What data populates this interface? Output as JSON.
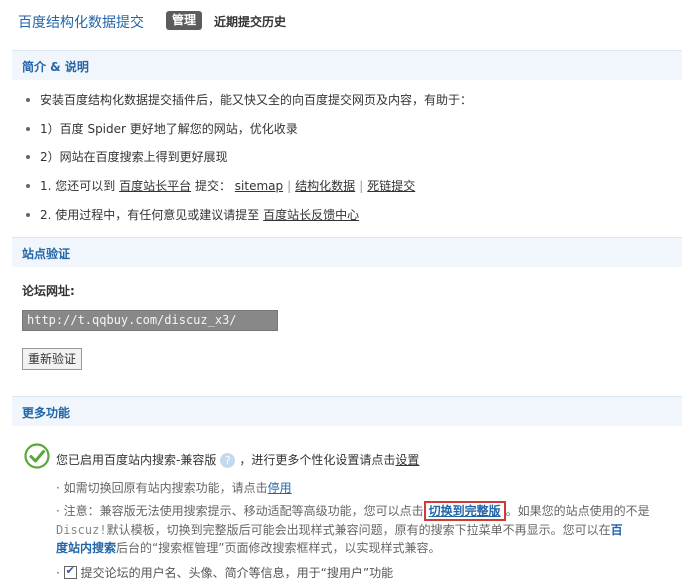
{
  "header": {
    "app_title": "百度结构化数据提交",
    "tab_manage": "管理",
    "tab_history": "近期提交历史"
  },
  "intro_section": {
    "title": "简介 & 说明",
    "lines": [
      "安装百度结构化数据提交插件后，能又快又全的向百度提交网页及内容，有助于：",
      "1）百度 Spider 更好地了解您的网站，优化收录",
      "2）网站在百度搜索上得到更好展现"
    ],
    "line4_prefix": "1. 您还可以到",
    "line4_link_platform": "百度站长平台",
    "line4_submit": "提交：",
    "line4_link_sitemap": "sitemap",
    "line4_link_structured": "结构化数据",
    "line4_link_deadlink": "死链提交",
    "line5_prefix": "2. 使用过程中，有任何意见或建议请提至",
    "line5_link_feedback": "百度站长反馈中心"
  },
  "verify_section": {
    "title": "站点验证",
    "forum_label": "论坛网址:",
    "forum_url": "http://t.qqbuy.com/discuz_x3/",
    "revalidate_button": "重新验证"
  },
  "more_section": {
    "title": "更多功能",
    "enabled_prefix": "您已启用百度站内搜索-兼容版",
    "help_icon_glyph": "?",
    "enabled_suffix": "，进行更多个性化设置请点击",
    "enabled_link": "设置",
    "switch_back_prefix": "· 如需切换回原有站内搜索功能，请点击",
    "switch_back_link": "停用",
    "note_prefix": "· 注意：兼容版无法使用搜索提示、移动适配等高级功能，您可以点击",
    "note_link_full": "切换到完整版",
    "note_mid": "。如果您的站点使用的不是",
    "note_discuz": "Discuz!",
    "note_line2": "默认模板，切换到完整版后可能会出现样式兼容问题，原有的搜索下拉菜单不再显示。您可以在",
    "note_link_baidu_search_a": "百",
    "note_link_baidu_search_b": "度站内搜索",
    "note_line3": "后台的“搜索框管理”页面修改搜索框样式，以实现样式兼容。",
    "checkbox_label": "提交论坛的用户名、头像、简介等信息，用于“搜用户”功能",
    "checkbox_prefix": "·"
  },
  "colors": {
    "accent": "#2366a8",
    "highlight_border": "#d23b35",
    "check_green": "#5aa83a"
  }
}
